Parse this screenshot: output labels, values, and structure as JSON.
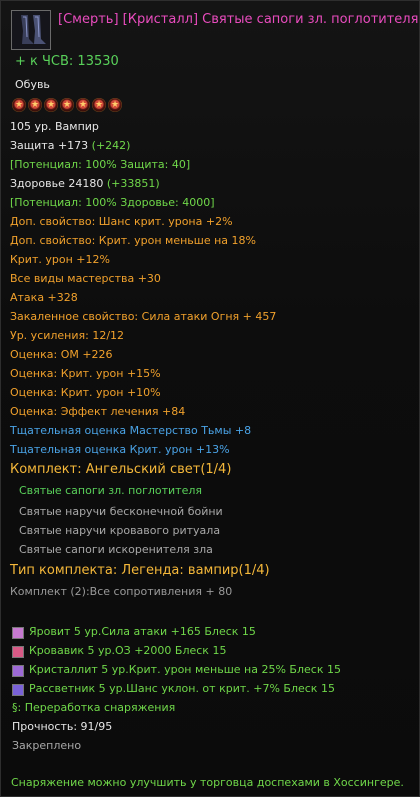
{
  "item": {
    "title": "[Смерть] [Кристалл] Святые сапоги зл. поглотителя",
    "cp": "+ к ЧСВ: 13530",
    "slot": "Обувь",
    "stars": 7,
    "level": "105 ур.   Вампир",
    "defense": "Защита +173",
    "defense_bonus": "(+242)",
    "potential_def": "[Потенциал: 100% Защита: 40]",
    "health": "Здоровье 24180",
    "health_bonus": "(+33851)",
    "potential_hp": "[Потенциал: 100% Здоровье: 4000]",
    "extra1": "Доп. свойство: Шанс крит. урона +2%",
    "extra2": "Доп. свойство: Крит. урон меньше на 18%",
    "crit": "Крит. урон +12%",
    "mastery": "Все виды мастерства +30",
    "attack": "Атака +328",
    "tempered": "Закаленное свойство: Сила атаки Огня + 457",
    "upgrade": "Ур. усиления: 12/12",
    "rating1": "Оценка:  ОМ +226",
    "rating2": "Оценка:  Крит. урон +15%",
    "rating3": "Оценка:  Крит. урон +10%",
    "rating4": "Оценка:  Эффект лечения +84",
    "thorough1": "Тщательная оценка Мастерство Тьмы +8",
    "thorough2": "Тщательная оценка Крит. урон +13%",
    "set_title": "Комплект: Ангельский свет(1/4)",
    "set_items": [
      "Святые сапоги зл. поглотителя",
      "Святые наручи бесконечной бойни",
      "Святые наручи кровавого ритуала",
      "Святые сапоги искоренителя зла"
    ],
    "set_type": "Тип комплекта: Легенда: вампир(1/4)",
    "set_bonus": "Комплект (2):Все сопротивления + 80",
    "gems": [
      "Яровит 5 ур.Сила атаки +165 Блеск 15",
      "Кровавик 5 ур.ОЗ +2000 Блеск 15",
      "Кристаллит 5 ур.Крит. урон меньше на 25% Блеск 15",
      "Рассветник 5 ур.Шанс уклон. от крит. +7% Блеск 15"
    ],
    "rework": "§: Переработка снаряжения",
    "durability": "Прочность: 91/95",
    "bound": "Закреплено",
    "footer": "Снаряжение можно улучшить у торговца доспехами в Хоссингере."
  },
  "colors": {
    "gem_colors": [
      "#c77ad1",
      "#d85a86",
      "#9d6ad6",
      "#7a62d8"
    ]
  }
}
